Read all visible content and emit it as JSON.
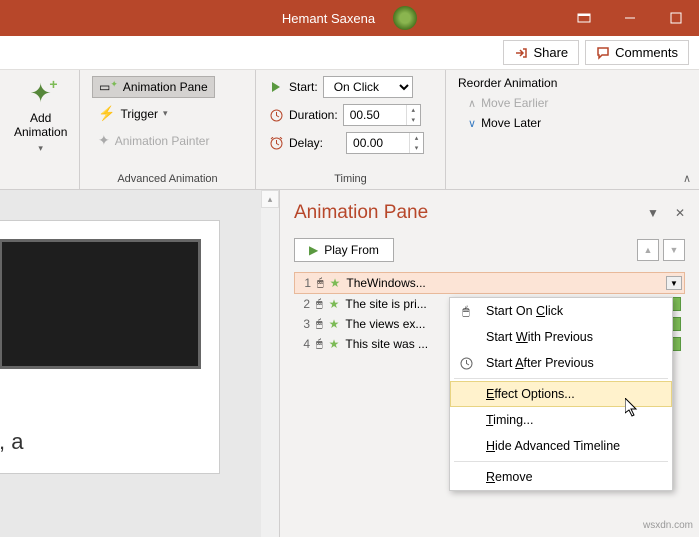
{
  "titlebar": {
    "title": "Hemant Saxena"
  },
  "header": {
    "share": "Share",
    "comments": "Comments"
  },
  "ribbon": {
    "addAnimation": {
      "line1": "Add",
      "line2": "Animation"
    },
    "advancedAnimation": {
      "label": "Advanced Animation",
      "animationPane": "Animation Pane",
      "trigger": "Trigger",
      "animationPainter": "Animation Painter"
    },
    "timing": {
      "label": "Timing",
      "startLabel": "Start:",
      "startValue": "On Click",
      "durationLabel": "Duration:",
      "durationValue": "00.50",
      "delayLabel": "Delay:",
      "delayValue": "00.00"
    },
    "reorder": {
      "title": "Reorder Animation",
      "moveEarlier": "Move Earlier",
      "moveLater": "Move Later"
    }
  },
  "slide": {
    "textFragment": ", a"
  },
  "animPane": {
    "title": "Animation Pane",
    "playFrom": "Play From",
    "items": [
      {
        "num": "1",
        "text": "TheWindows..."
      },
      {
        "num": "2",
        "text": "The site is pri..."
      },
      {
        "num": "3",
        "text": "The views ex..."
      },
      {
        "num": "4",
        "text": "This site was ..."
      }
    ]
  },
  "contextMenu": {
    "startOnClick": {
      "pre": "Start On ",
      "u": "C",
      "post": "lick"
    },
    "startWithPrevious": {
      "pre": "Start ",
      "u": "W",
      "post": "ith Previous"
    },
    "startAfterPrevious": {
      "pre": "Start ",
      "u": "A",
      "post": "fter Previous"
    },
    "effectOptions": {
      "pre": "",
      "u": "E",
      "post": "ffect Options..."
    },
    "timing": {
      "pre": "",
      "u": "T",
      "post": "iming..."
    },
    "hideAdvanced": {
      "pre": "",
      "u": "H",
      "post": "ide Advanced Timeline"
    },
    "remove": {
      "pre": "",
      "u": "R",
      "post": "emove"
    }
  },
  "watermark": "wsxdn.com"
}
